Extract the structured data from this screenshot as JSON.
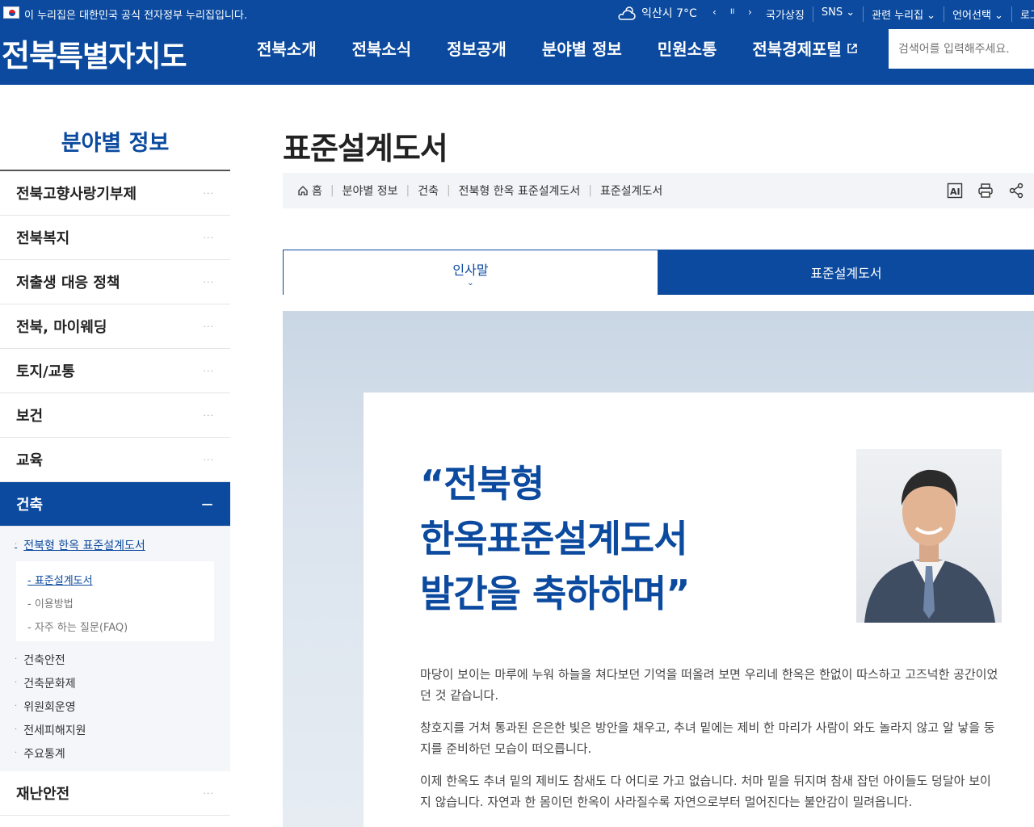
{
  "govbar": {
    "text": "이 누리집은 대한민국 공식 전자정부 누리집입니다.",
    "weather": "익산시 7°C",
    "ctrl_prev": "‹",
    "ctrl_pause": "II",
    "ctrl_next": "›",
    "utils": [
      "국가상징",
      "SNS ⌄",
      "관련 누리집 ⌄",
      "언어선택 ⌄",
      "로그인"
    ]
  },
  "header": {
    "logo_a": "전북",
    "logo_b": "특별자치도",
    "nav": [
      "전북소개",
      "전북소식",
      "정보공개",
      "분야별 정보",
      "민원소통",
      "전북경제포털"
    ],
    "search_placeholder": "검색어를 입력해주세요."
  },
  "lnb": {
    "title": "분야별 정보",
    "items_top": [
      "전북고향사랑기부제",
      "전북복지",
      "저출생 대응 정책",
      "전북, 마이웨딩",
      "토지/교통",
      "보건",
      "교육"
    ],
    "active": "건축",
    "active_icon": "−",
    "sub": {
      "first": "전북형 한옥 표준설계도서",
      "box": [
        "- 표준설계도서",
        "- 이용방법",
        "- 자주 하는 질문(FAQ)"
      ],
      "rest": [
        "건축안전",
        "건축문화제",
        "위원회운영",
        "전세피해지원",
        "주요통계"
      ]
    },
    "items_bottom": [
      "재난안전"
    ],
    "dots": "···"
  },
  "page": {
    "title": "표준설계도서",
    "breadcrumb": [
      "홈",
      "분야별 정보",
      "건축",
      "전북형 한옥 표준설계도서",
      "표준설계도서"
    ],
    "tabs": [
      "인사말",
      "표준설계도서"
    ],
    "quote": [
      "“전북형",
      "한옥표준설계도서",
      "발간을 축하하며”"
    ],
    "paragraphs": [
      "마당이 보이는 마루에 누워 하늘을 쳐다보던 기억을 떠올려 보면 우리네 한옥은 한없이 따스하고 고즈넉한 공간이었던 것 같습니다.",
      "창호지를 거쳐 통과된 은은한 빛은 방안을 채우고, 추녀 밑에는 제비 한 마리가 사람이 와도 놀라지 않고 알 낳을 둥지를 준비하던 모습이 떠오릅니다.",
      "이제 한옥도 추녀 밑의 제비도 참새도 다 어디로 가고 없습니다. 처마 밑을 뒤지며 참새 잡던 아이들도 덩달아 보이지 않습니다. 자연과 한 몸이던 한옥이 사라질수록 자연으로부터 멀어진다는 불안감이 밀려옵니다."
    ]
  }
}
